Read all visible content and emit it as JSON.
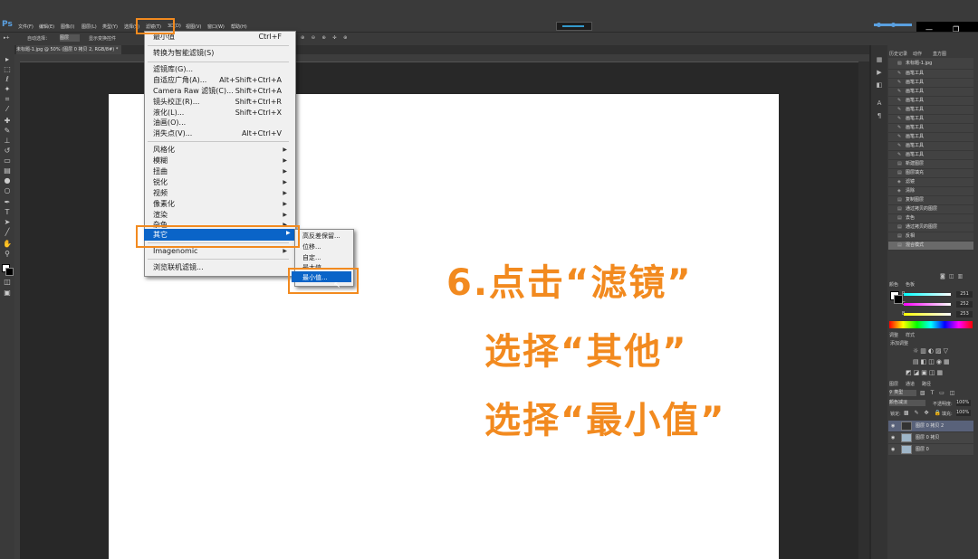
{
  "menubar": {
    "logo": "Ps",
    "items": [
      "文件(F)",
      "编辑(E)",
      "图像(I)",
      "图层(L)",
      "类型(Y)",
      "选择(S)",
      "滤镜(T)",
      "3D(D)",
      "视图(V)",
      "窗口(W)",
      "帮助(H)"
    ]
  },
  "options": {
    "auto_select": "自动选择：",
    "dropdown": "图层",
    "transform": "显示变换控件"
  },
  "document": {
    "tab_title": "未标题-1.jpg @ 50% (图层 0 拷贝 2, RGB/8#) *"
  },
  "filter_menu": {
    "last_filter": {
      "label": "最小值",
      "shortcut": "Ctrl+F"
    },
    "smart": "转换为智能滤镜(S)",
    "group2": [
      {
        "label": "滤镜库(G)...",
        "shortcut": ""
      },
      {
        "label": "自适应广角(A)...",
        "shortcut": "Alt+Shift+Ctrl+A"
      },
      {
        "label": "Camera Raw 滤镜(C)...",
        "shortcut": "Shift+Ctrl+A"
      },
      {
        "label": "镜头校正(R)...",
        "shortcut": "Shift+Ctrl+R"
      },
      {
        "label": "液化(L)...",
        "shortcut": "Shift+Ctrl+X"
      },
      {
        "label": "油画(O)...",
        "shortcut": ""
      },
      {
        "label": "消失点(V)...",
        "shortcut": "Alt+Ctrl+V"
      }
    ],
    "group3": [
      "风格化",
      "模糊",
      "扭曲",
      "锐化",
      "视频",
      "像素化",
      "渲染",
      "杂色"
    ],
    "other": "其它",
    "imagenomic": "Imagenomic",
    "browse": "浏览联机滤镜..."
  },
  "submenu": {
    "items": [
      "高反差保留...",
      "位移...",
      "自定...",
      "最大值..."
    ],
    "selected": "最小值..."
  },
  "annotation": {
    "line1": "6.点击“滤镜”",
    "line2": "选择“其他”",
    "line3": "选择“最小值”"
  },
  "panels": {
    "tabs": [
      "历史记录",
      "动作",
      "直方图"
    ],
    "snapshot": "未标题-1.jpg",
    "history": [
      "画笔工具",
      "画笔工具",
      "画笔工具",
      "画笔工具",
      "画笔工具",
      "画笔工具",
      "画笔工具",
      "画笔工具",
      "画笔工具",
      "画笔工具",
      "新建图层",
      "图层填充",
      "滤镜",
      "清除",
      "复制图层",
      "通过拷贝的图层",
      "去色",
      "通过拷贝的图层",
      "反相",
      "混合模式"
    ],
    "color_tabs": [
      "颜色",
      "色板"
    ],
    "color_values": {
      "R": "251",
      "G": "252",
      "B": "253"
    },
    "adjust_tabs": [
      "调整",
      "样式"
    ],
    "adjust_title": "添加调整",
    "layer_tabs": [
      "图层",
      "通道",
      "路径"
    ],
    "blend_mode": "颜色减淡",
    "opacity_label": "不透明度:",
    "opacity": "100%",
    "fill_label": "填充:",
    "fill": "100%",
    "lock_label": "锁定:",
    "layers": [
      "图层 0 拷贝 2",
      "图层 0 拷贝",
      "图层 0"
    ]
  },
  "colors": {
    "accent": "#f28a1f",
    "highlight": "#0a64c8"
  }
}
